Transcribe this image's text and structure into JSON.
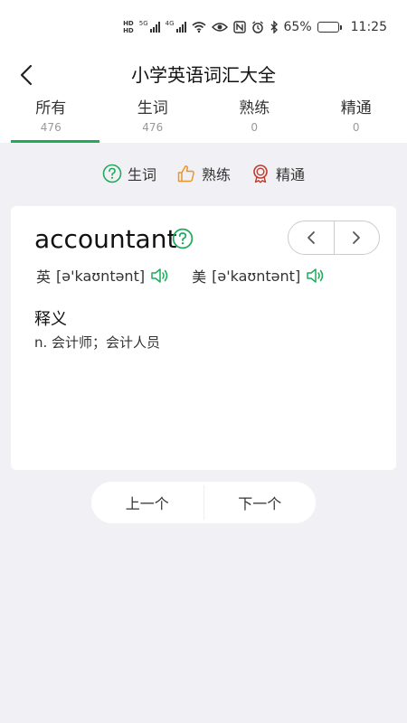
{
  "status_bar": {
    "hd_top": "HD",
    "hd_bottom": "HD",
    "net_5g": "5G",
    "net_4g": "4G",
    "battery_percent": "65%",
    "battery_level": 0.65,
    "time": "11:25"
  },
  "header": {
    "title": "小学英语词汇大全"
  },
  "tabs": [
    {
      "label": "所有",
      "count": "476"
    },
    {
      "label": "生词",
      "count": "476"
    },
    {
      "label": "熟练",
      "count": "0"
    },
    {
      "label": "精通",
      "count": "0"
    }
  ],
  "active_tab_index": 0,
  "legend": {
    "new_label": "生词",
    "familiar_label": "熟练",
    "mastered_label": "精通"
  },
  "word": {
    "text": "accountant",
    "uk_label": "英",
    "uk_phonetic": "[ə'kaʊntənt]",
    "us_label": "美",
    "us_phonetic": "[ə'kaʊntənt]",
    "meaning_title": "释义",
    "meaning": "n. 会计师；会计人员"
  },
  "nav": {
    "prev_label": "上一个",
    "next_label": "下一个"
  },
  "colors": {
    "accent_green": "#1fab5c",
    "familiar_orange": "#e8962b",
    "mastered_red": "#c0392b",
    "background": "#f1f1f5"
  }
}
